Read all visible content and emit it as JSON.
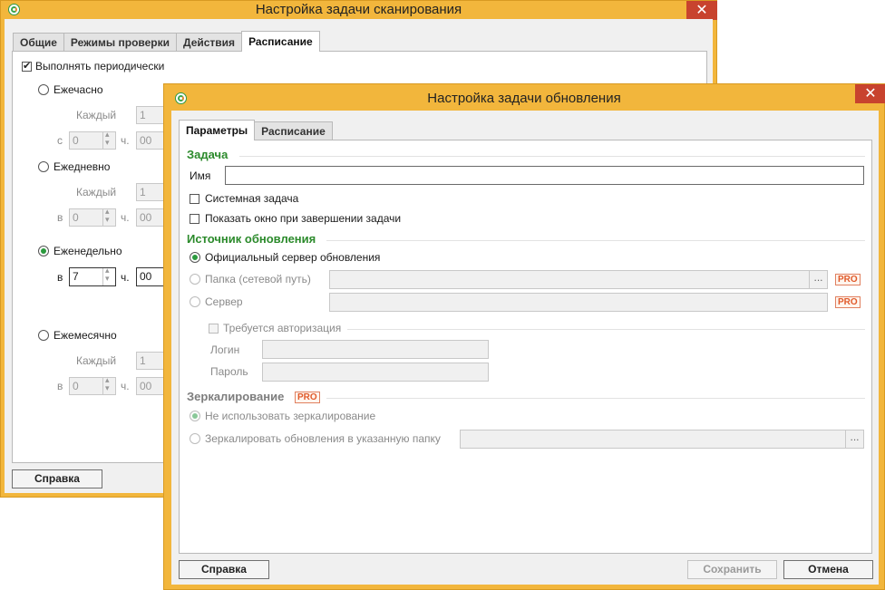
{
  "scan_window": {
    "title": "Настройка задачи сканирования",
    "tabs": [
      "Общие",
      "Режимы проверки",
      "Действия",
      "Расписание"
    ],
    "periodic_label": "Выполнять периодически",
    "hourly": {
      "label": "Ежечасно",
      "every_label": "Каждый",
      "every_value": "1",
      "from_label": "с",
      "hour_value": "0",
      "h_label": "ч.",
      "min_value": "00"
    },
    "daily": {
      "label": "Ежедневно",
      "every_label": "Каждый",
      "every_value": "1",
      "in_label": "в",
      "hour_value": "0",
      "h_label": "ч.",
      "min_value": "00"
    },
    "weekly": {
      "label": "Еженедельно",
      "in_label": "в",
      "hour_value": "7",
      "h_label": "ч.",
      "min_value": "00"
    },
    "monthly": {
      "label": "Ежемесячно",
      "every_label": "Каждый",
      "every_value": "1",
      "in_label": "в",
      "hour_value": "0",
      "h_label": "ч.",
      "min_value": "00"
    },
    "help_button": "Справка"
  },
  "update_window": {
    "title": "Настройка задачи обновления",
    "tabs": [
      "Параметры",
      "Расписание"
    ],
    "task_section": "Задача",
    "name_label": "Имя",
    "name_value": "",
    "system_task_label": "Системная задача",
    "show_window_label": "Показать окно при завершении задачи",
    "source_section": "Источник обновления",
    "official_server_label": "Официальный сервер обновления",
    "folder_label": "Папка (сетевой путь)",
    "server_label": "Сервер",
    "auth_required_label": "Требуется авторизация",
    "login_label": "Логин",
    "password_label": "Пароль",
    "mirror_section": "Зеркалирование",
    "no_mirror_label": "Не использовать зеркалирование",
    "mirror_to_folder_label": "Зеркалировать обновления в указанную папку",
    "pro_badge": "PRO",
    "browse_label": "...",
    "help_button": "Справка",
    "save_button": "Сохранить",
    "cancel_button": "Отмена",
    "colors": {
      "frame": "#f2b63c",
      "section": "#2b8a2b",
      "close": "#c8432e",
      "pro": "#e05a2a"
    }
  }
}
